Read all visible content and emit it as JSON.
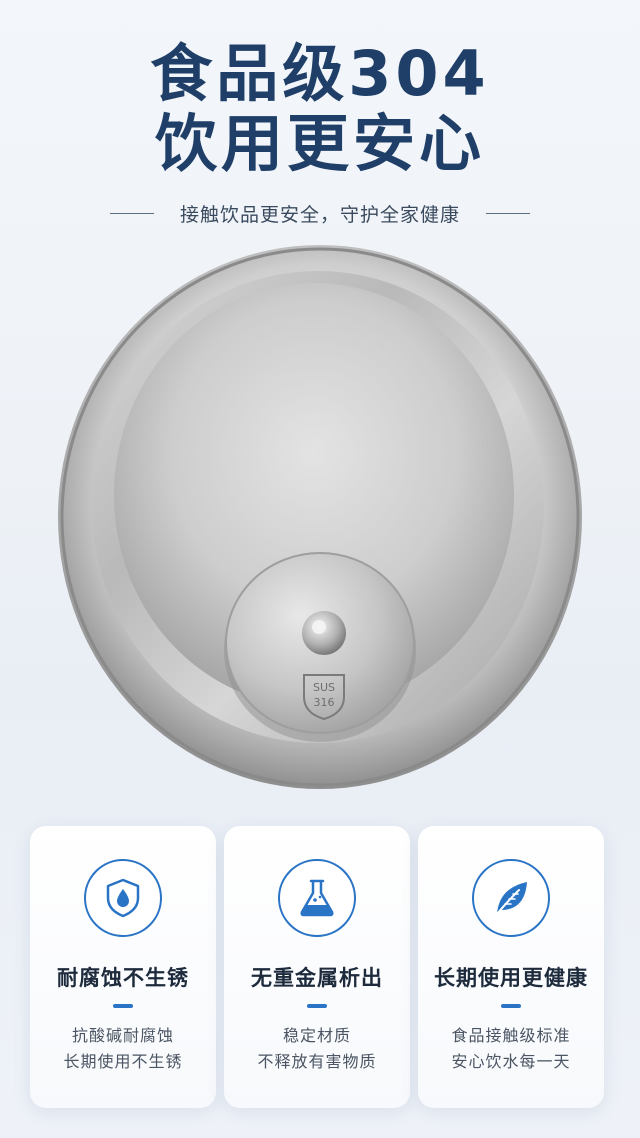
{
  "headline": {
    "line1": "食品级304",
    "line2": "饮用更安心"
  },
  "subtitle": "接触饮品更安全，守护全家健康",
  "product": {
    "badge_text_top": "SUS",
    "badge_text_bottom": "316"
  },
  "features": [
    {
      "icon": "shield-drop-icon",
      "title": "耐腐蚀不生锈",
      "line1": "抗酸碱耐腐蚀",
      "line2": "长期使用不生锈"
    },
    {
      "icon": "flask-icon",
      "title": "无重金属析出",
      "line1": "稳定材质",
      "line2": "不释放有害物质"
    },
    {
      "icon": "leaf-icon",
      "title": "长期使用更健康",
      "line1": "食品接触级标准",
      "line2": "安心饮水每一天"
    }
  ],
  "colors": {
    "headline": "#1f3f68",
    "accent": "#2a74c6"
  }
}
